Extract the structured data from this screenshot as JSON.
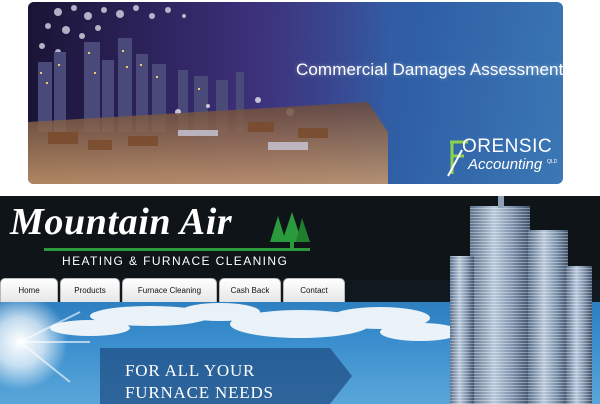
{
  "banner_top": {
    "headline": "Commercial Damages Assessment",
    "logo": {
      "line1": "ORENSIC",
      "line2": "Accounting",
      "suffix": "QLD"
    }
  },
  "site": {
    "brand": {
      "name": "Mountain Air",
      "tagline": "HEATING & FURNACE CLEANING"
    },
    "nav": {
      "items": [
        {
          "label": "Home"
        },
        {
          "label": "Products"
        },
        {
          "label": "Furnace Cleaning"
        },
        {
          "label": "Cash Back"
        },
        {
          "label": "Contact"
        }
      ]
    },
    "hero": {
      "line1": "FOR ALL YOUR",
      "line2": "FURNACE NEEDS"
    }
  },
  "colors": {
    "brand_green": "#2a9a3c",
    "header_bg": "#0e1418",
    "sky_blue": "#3b8fce",
    "banner_purple": "#4a3a86"
  }
}
